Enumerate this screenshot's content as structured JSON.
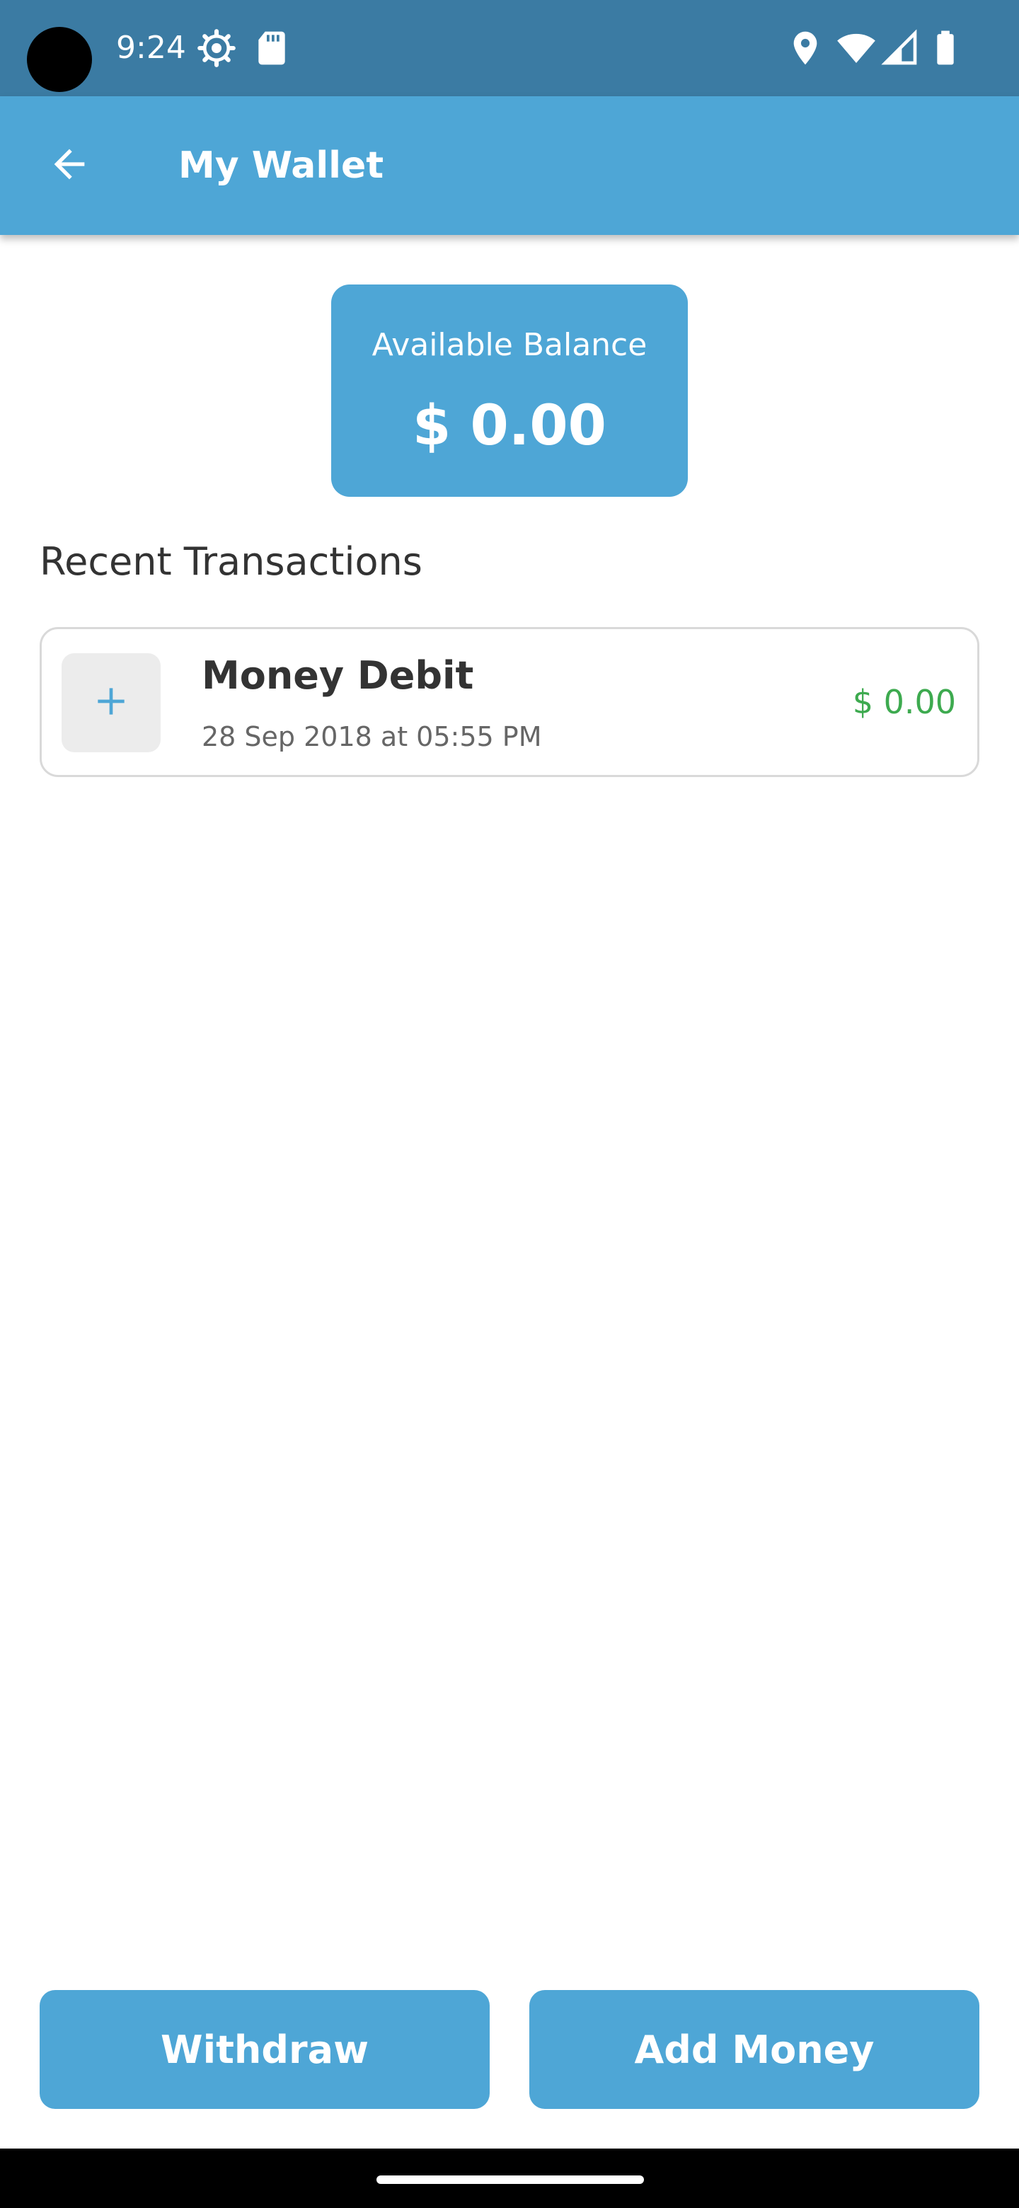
{
  "status_bar": {
    "time": "9:24",
    "icons": [
      "settings-icon",
      "sd-card-icon",
      "location-icon",
      "wifi-icon",
      "signal-icon",
      "battery-icon"
    ]
  },
  "app_bar": {
    "title": "My Wallet",
    "back_icon": "arrow-back-icon"
  },
  "balance": {
    "label": "Available Balance",
    "amount": "$ 0.00"
  },
  "transactions": {
    "section_title": "Recent Transactions",
    "items": [
      {
        "icon": "plus-icon",
        "title": "Money Debit",
        "date": "28 Sep 2018 at 05:55 PM",
        "amount": "$ 0.00"
      }
    ]
  },
  "actions": {
    "withdraw_label": "Withdraw",
    "add_money_label": "Add Money"
  },
  "colors": {
    "status_bar": "#3b7ba3",
    "primary": "#4ea6d6",
    "amount_positive": "#3daa4f"
  }
}
